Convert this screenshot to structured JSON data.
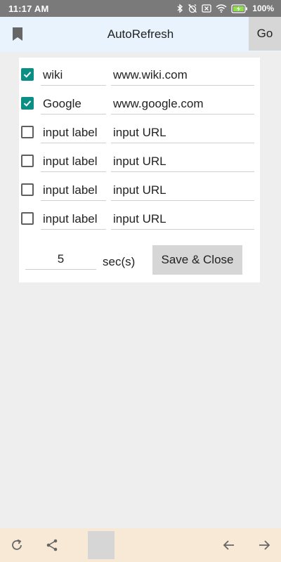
{
  "status_bar": {
    "time": "11:17 AM",
    "battery_pct": "100",
    "icons": [
      "bluetooth-icon",
      "alarm-off-icon",
      "sim-off-icon",
      "wifi-icon",
      "battery-charging-icon"
    ]
  },
  "app_bar": {
    "title": "AutoRefresh",
    "go_label": "Go",
    "leading_icon": "bookmark-icon"
  },
  "entries": [
    {
      "checked": true,
      "label": "wiki",
      "url": "www.wiki.com"
    },
    {
      "checked": true,
      "label": "Google",
      "url": "www.google.com"
    },
    {
      "checked": false,
      "label": "input label",
      "url": "input URL"
    },
    {
      "checked": false,
      "label": "input label",
      "url": "input URL"
    },
    {
      "checked": false,
      "label": "input label",
      "url": "input URL"
    },
    {
      "checked": false,
      "label": "input label",
      "url": "input URL"
    }
  ],
  "interval": {
    "value": "5",
    "unit_label": "sec(s)"
  },
  "save_label": "Save & Close",
  "bottom_bar": {
    "icons": [
      "refresh-icon",
      "share-icon",
      "tab-thumbnail",
      "back-arrow-icon",
      "forward-arrow-icon"
    ]
  },
  "colors": {
    "accent": "#0b8f84",
    "app_bar_bg": "#e9f3fd",
    "bottom_bar_bg": "#f8e9d6",
    "status_bar_bg": "#7a7a7a",
    "button_bg": "#d6d6d6"
  }
}
